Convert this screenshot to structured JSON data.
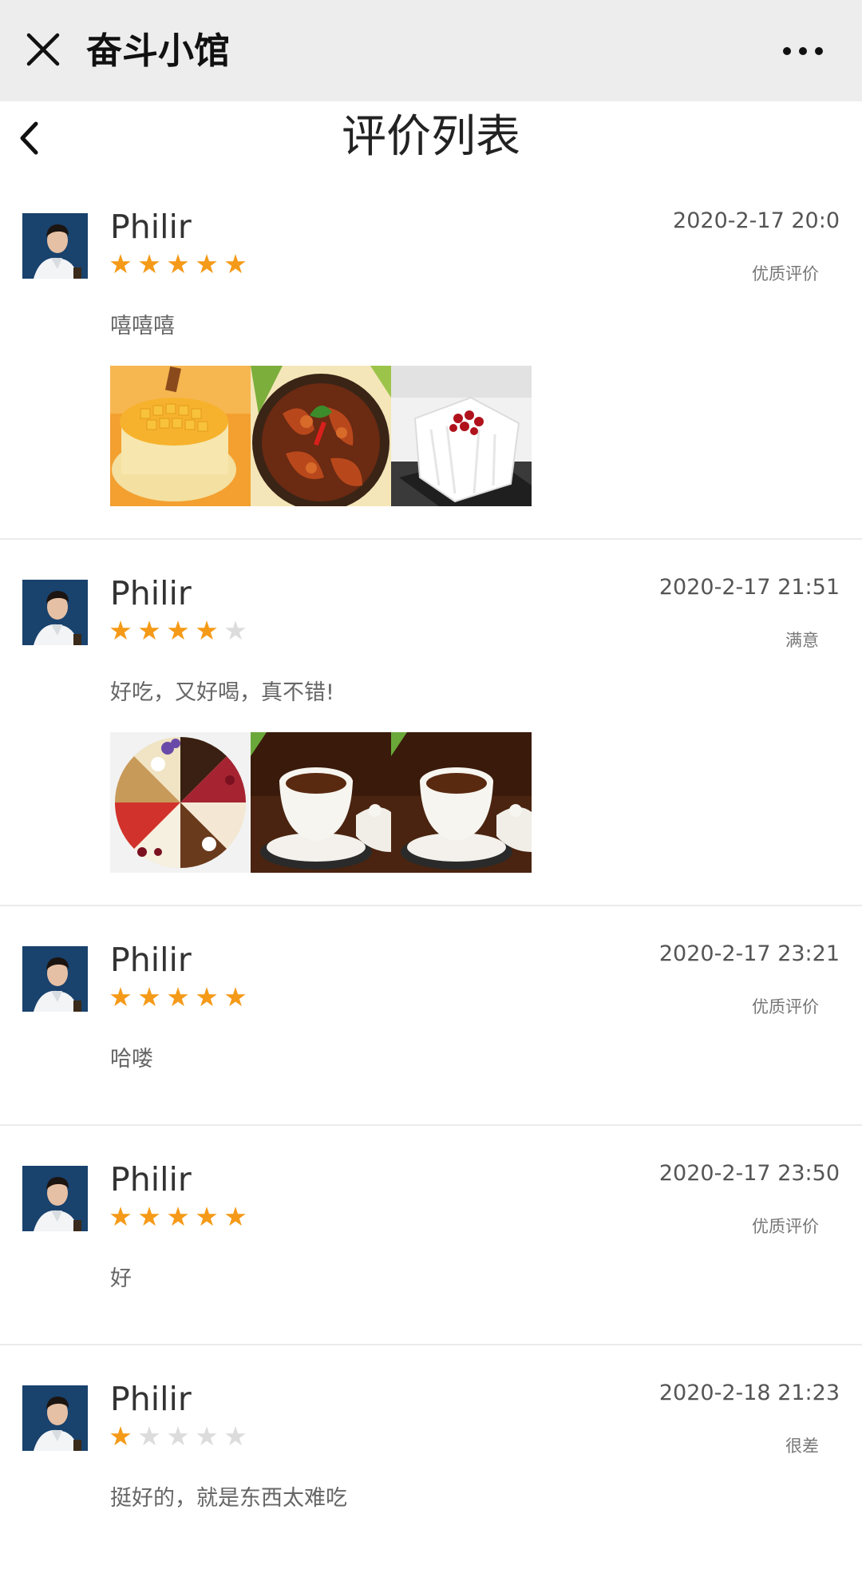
{
  "header": {
    "title": "奋斗小馆",
    "close_icon": "close-icon",
    "more_icon": "more-icon"
  },
  "nav": {
    "title": "评价列表",
    "back_icon": "back-arrow-icon"
  },
  "colors": {
    "star_on": "#f59a18",
    "star_off": "#dcdcdc",
    "topbar": "#ededed"
  },
  "reviews": [
    {
      "username": "Philir",
      "timestamp": "2020-2-17 20:0",
      "rating": 5,
      "rating_label": "优质评价",
      "comment": "嘻嘻嘻",
      "photos": [
        "mango-cake-photo",
        "braised-duck-photo",
        "white-cake-photo"
      ]
    },
    {
      "username": "Philir",
      "timestamp": "2020-2-17 21:51",
      "rating": 4,
      "rating_label": "满意",
      "comment": "好吃，又好喝，真不错!",
      "photos": [
        "assorted-cake-photo",
        "tea-cup-photo",
        "tea-cup-photo"
      ]
    },
    {
      "username": "Philir",
      "timestamp": "2020-2-17 23:21",
      "rating": 5,
      "rating_label": "优质评价",
      "comment": "哈喽",
      "photos": []
    },
    {
      "username": "Philir",
      "timestamp": "2020-2-17 23:50",
      "rating": 5,
      "rating_label": "优质评价",
      "comment": "好",
      "photos": []
    },
    {
      "username": "Philir",
      "timestamp": "2020-2-18 21:23",
      "rating": 1,
      "rating_label": "很差",
      "comment": "挺好的，就是东西太难吃",
      "photos": []
    }
  ]
}
